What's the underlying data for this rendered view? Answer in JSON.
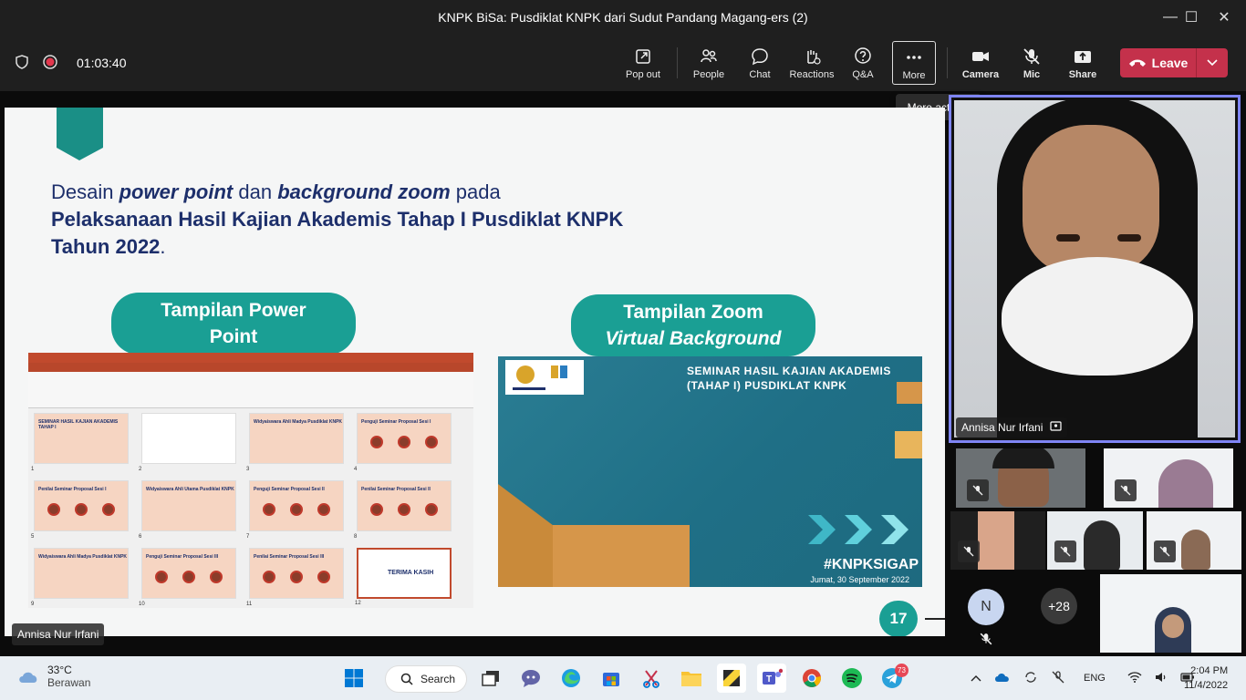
{
  "window": {
    "title": "KNPK BiSa: Pusdiklat KNPK dari Sudut Pandang Magang-ers (2)"
  },
  "meeting": {
    "elapsed": "01:03:40"
  },
  "toolbar": {
    "popout": "Pop out",
    "people": "People",
    "chat": "Chat",
    "reactions": "Reactions",
    "qa": "Q&A",
    "more": "More",
    "camera": "Camera",
    "mic": "Mic",
    "share": "Share",
    "leave": "Leave",
    "tooltip": "More actions"
  },
  "slide": {
    "title_line1_a": "Desain ",
    "title_line1_b": "power point",
    "title_line1_c": " dan ",
    "title_line1_d": "background zoom",
    "title_line1_e": " pada",
    "title_line2": "Pelaksanaan Hasil Kajian Akademis Tahap I Pusdiklat KNPK",
    "title_line3": "Tahun 2022",
    "title_line3_dot": ".",
    "pill_left_1": "Tampilan Power",
    "pill_left_2": "Point",
    "pill_right_1": "Tampilan Zoom",
    "pill_right_2": "Virtual Background",
    "zoom_title_1": "SEMINAR HASIL KAJIAN AKADEMIS",
    "zoom_title_2": "(TAHAP I) PUSDIKLAT KNPK",
    "zoom_hashtag": "#KNPKSIGAP",
    "zoom_date": "Jumat, 30 September 2022",
    "page_number": "17",
    "ppt_thumbs": [
      {
        "num": "1",
        "text": "SEMINAR HASIL KAJIAN AKADEMIS TAHAP I"
      },
      {
        "num": "2",
        "text": ""
      },
      {
        "num": "3",
        "text": "Widyaiswara Ahli Madya Pusdiklat KNPK"
      },
      {
        "num": "4",
        "text": "Penguji Seminar Proposal Sesi I"
      },
      {
        "num": "5",
        "text": "Penilai Seminar Proposal Sesi I"
      },
      {
        "num": "6",
        "text": "Widyaiswara Ahli Utama Pusdiklat KNPK"
      },
      {
        "num": "7",
        "text": "Penguji Seminar Proposal Sesi II"
      },
      {
        "num": "8",
        "text": "Penilai Seminar Proposal Sesi II"
      },
      {
        "num": "9",
        "text": "Widyaiswara Ahli Madya Pusdiklat KNPK"
      },
      {
        "num": "10",
        "text": "Penguji Seminar Proposal Sesi III"
      },
      {
        "num": "11",
        "text": "Penilai Seminar Proposal Sesi III"
      },
      {
        "num": "12",
        "text": "TERIMA KASIH"
      }
    ]
  },
  "participants": {
    "presenter_label": "Annisa Nur Irfani",
    "featured_name": "Annisa Nur Irfani",
    "avatar_initial": "N",
    "overflow_count": "+28"
  },
  "taskbar": {
    "temperature": "33°C",
    "weather": "Berawan",
    "search": "Search",
    "language": "ENG",
    "time": "2:04 PM",
    "date": "11/4/2022",
    "telegram_badge": "73"
  }
}
